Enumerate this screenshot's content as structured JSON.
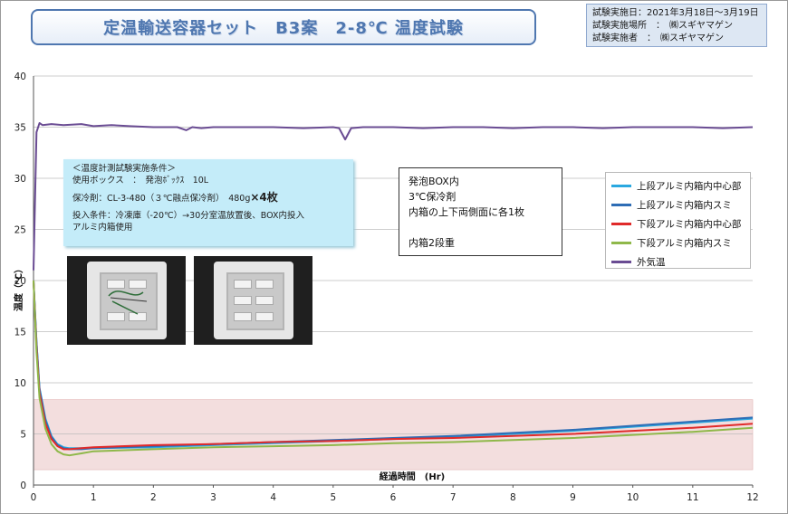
{
  "title": "定温輸送容器セット　B3案　2-8℃ 温度試験",
  "info": {
    "date": "試験実施日：2021年3月18日～3月19日",
    "place": "試験実施場所　：　㈱スギヤマゲン",
    "person": "試験実施者　：　㈱スギヤマゲン"
  },
  "conditions": {
    "heading": "＜温度計測試験実施条件＞",
    "box": "使用ボックス　：　発泡ﾎﾞｯｸｽ　10L",
    "coolant_prefix": "保冷剤：CL-3-480（３℃融点保冷剤）　480g",
    "coolant_qty": "×4枚",
    "input_line1": "投入条件：冷凍庫（-20℃）→30分室温放置後、BOX内投入",
    "input_line2": "アルミ内箱使用"
  },
  "note": {
    "line1": "発泡BOX内",
    "line2": "3℃保冷剤",
    "line3": "内箱の上下両側面に各1枚",
    "line4": "内箱2段重"
  },
  "colors": {
    "series1": "#2aa8e0",
    "series2": "#2e6db5",
    "series3": "#e02a2a",
    "series4": "#8fb84a",
    "series5": "#6a4c93",
    "band": "#f3dede",
    "title": "#4f77b0"
  },
  "chart_data": {
    "type": "line",
    "xlabel": "経過時間　(Hr)",
    "ylabel": "温度（℃）",
    "xlim": [
      0,
      12
    ],
    "ylim": [
      0,
      40
    ],
    "x_ticks": [
      0,
      1,
      2,
      3,
      4,
      5,
      6,
      7,
      8,
      9,
      10,
      11,
      12
    ],
    "y_ticks": [
      0,
      5,
      10,
      15,
      20,
      25,
      30,
      35,
      40
    ],
    "grid": "horizontal",
    "target_band": [
      2,
      8
    ],
    "legend_position": "right",
    "series": [
      {
        "name": "上段アルミ内箱内中心部",
        "x": [
          0,
          0.05,
          0.1,
          0.2,
          0.3,
          0.4,
          0.5,
          0.6,
          0.8,
          1,
          2,
          3,
          4,
          5,
          6,
          7,
          8,
          9,
          10,
          11,
          12
        ],
        "y": [
          20,
          14,
          9.5,
          6.5,
          4.8,
          4.0,
          3.7,
          3.6,
          3.6,
          3.6,
          3.7,
          3.9,
          4.1,
          4.3,
          4.5,
          4.7,
          5.0,
          5.3,
          5.7,
          6.1,
          6.5
        ]
      },
      {
        "name": "上段アルミ内箱内スミ",
        "x": [
          0,
          0.05,
          0.1,
          0.2,
          0.3,
          0.4,
          0.5,
          0.6,
          0.8,
          1,
          2,
          3,
          4,
          5,
          6,
          7,
          8,
          9,
          10,
          11,
          12
        ],
        "y": [
          20,
          14,
          9.4,
          6.3,
          4.7,
          3.9,
          3.6,
          3.5,
          3.5,
          3.6,
          3.8,
          4.0,
          4.2,
          4.4,
          4.6,
          4.8,
          5.1,
          5.4,
          5.8,
          6.2,
          6.6
        ]
      },
      {
        "name": "下段アルミ内箱内中心部",
        "x": [
          0,
          0.05,
          0.1,
          0.2,
          0.3,
          0.4,
          0.5,
          0.6,
          0.8,
          1,
          2,
          3,
          4,
          5,
          6,
          7,
          8,
          9,
          10,
          11,
          12
        ],
        "y": [
          20,
          13.5,
          9.0,
          6.0,
          4.5,
          3.8,
          3.5,
          3.5,
          3.6,
          3.7,
          3.9,
          4.0,
          4.2,
          4.3,
          4.5,
          4.6,
          4.8,
          5.0,
          5.3,
          5.6,
          6.0
        ]
      },
      {
        "name": "下段アルミ内箱内スミ",
        "x": [
          0,
          0.05,
          0.1,
          0.2,
          0.3,
          0.4,
          0.5,
          0.6,
          0.8,
          1,
          2,
          3,
          4,
          5,
          6,
          7,
          8,
          9,
          10,
          11,
          12
        ],
        "y": [
          20,
          13,
          8.5,
          5.5,
          4.0,
          3.3,
          3.0,
          2.9,
          3.1,
          3.3,
          3.5,
          3.7,
          3.8,
          3.9,
          4.1,
          4.2,
          4.4,
          4.6,
          4.9,
          5.2,
          5.6
        ]
      },
      {
        "name": "外気温",
        "x": [
          0,
          0.05,
          0.1,
          0.15,
          0.3,
          0.5,
          0.8,
          1.0,
          1.3,
          1.6,
          2.0,
          2.4,
          2.55,
          2.65,
          2.8,
          3.0,
          3.5,
          4.0,
          4.5,
          5.0,
          5.1,
          5.2,
          5.3,
          5.5,
          6.0,
          6.5,
          7.0,
          7.5,
          8.0,
          8.5,
          9.0,
          9.5,
          10.0,
          10.5,
          11.0,
          11.5,
          12.0
        ],
        "y": [
          21,
          34.5,
          35.4,
          35.2,
          35.3,
          35.2,
          35.3,
          35.1,
          35.2,
          35.1,
          35.0,
          35.0,
          34.7,
          35.0,
          34.9,
          35.0,
          35.0,
          35.0,
          34.9,
          35.0,
          34.9,
          33.8,
          34.9,
          35.0,
          35.0,
          34.9,
          35.0,
          35.0,
          34.9,
          35.0,
          35.0,
          34.9,
          35.0,
          35.0,
          35.0,
          34.9,
          35.0
        ]
      }
    ]
  }
}
